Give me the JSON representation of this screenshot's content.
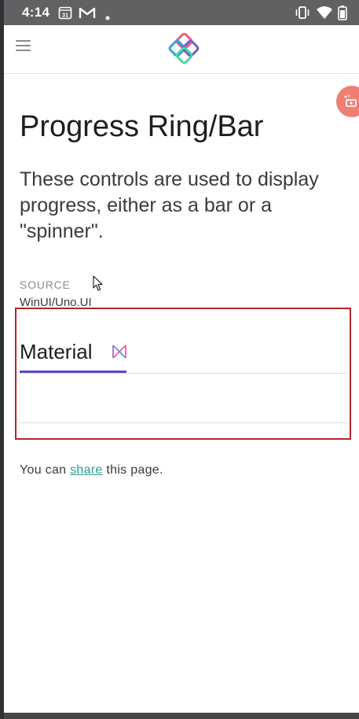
{
  "status_bar": {
    "time": "4:14",
    "calendar_day": "31",
    "icons": [
      "calendar-icon",
      "gmail-icon",
      "dot-icon",
      "vibrate-icon",
      "wifi-icon",
      "battery-icon"
    ]
  },
  "nav": {
    "icons": [
      "hamburger-menu-icon",
      "app-logo-icon"
    ]
  },
  "fab": {
    "icon": "share-fab-icon",
    "color": "#ef7f72"
  },
  "page": {
    "title": "Progress Ring/Bar",
    "description": "These controls are used to display progress, either as a bar or a \"spinner\".",
    "source_label": "SOURCE",
    "source_value": "WinUI/Uno.UI"
  },
  "tabs": [
    {
      "label": "Material",
      "icon": "material-icon",
      "selected": true
    }
  ],
  "footer": {
    "prefix": "You can ",
    "link": "share",
    "suffix": " this page."
  },
  "colors": {
    "accent_underline": "#5a4bd1",
    "link": "#2a9d8f",
    "highlight_border": "#b3262e",
    "status_bar": "#5f6163"
  }
}
